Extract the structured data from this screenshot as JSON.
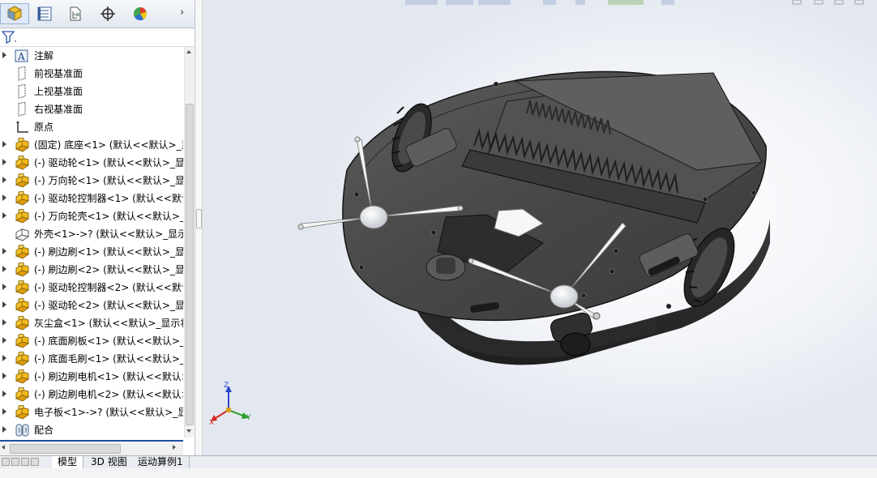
{
  "panel": {
    "tabs": [
      {
        "name": "feature-manager-tab-icon"
      },
      {
        "name": "property-manager-tab-icon"
      },
      {
        "name": "configuration-manager-tab-icon"
      },
      {
        "name": "dimxpert-manager-tab-icon"
      },
      {
        "name": "display-manager-tab-icon"
      }
    ],
    "more_arrow": "›",
    "filter_icon": "filter-icon",
    "tree": [
      {
        "label": "注解",
        "icon": "annotation-icon",
        "expandable": true
      },
      {
        "label": "前视基准面",
        "icon": "plane-icon",
        "expandable": false
      },
      {
        "label": "上视基准面",
        "icon": "plane-icon",
        "expandable": false
      },
      {
        "label": "右视基准面",
        "icon": "plane-icon",
        "expandable": false
      },
      {
        "label": "原点",
        "icon": "origin-icon",
        "expandable": false
      },
      {
        "label": "(固定) 底座<1> (默认<<默认>_显",
        "icon": "part-icon",
        "expandable": true
      },
      {
        "label": "(-) 驱动轮<1> (默认<<默认>_显示",
        "icon": "part-icon",
        "expandable": true
      },
      {
        "label": "(-) 万向轮<1> (默认<<默认>_显示",
        "icon": "part-icon",
        "expandable": true
      },
      {
        "label": "(-) 驱动轮控制器<1> (默认<<默认",
        "icon": "part-icon",
        "expandable": true
      },
      {
        "label": "(-) 万向轮壳<1> (默认<<默认>_显",
        "icon": "part-icon",
        "expandable": true
      },
      {
        "label": "外壳<1>->? (默认<<默认>_显示",
        "icon": "part-outline-icon",
        "expandable": false
      },
      {
        "label": "(-) 刷边刷<1> (默认<<默认>_显示",
        "icon": "part-icon",
        "expandable": true
      },
      {
        "label": "(-) 刷边刷<2> (默认<<默认>_显示",
        "icon": "part-icon",
        "expandable": true
      },
      {
        "label": "(-) 驱动轮控制器<2> (默认<<默认",
        "icon": "part-icon",
        "expandable": true
      },
      {
        "label": "(-) 驱动轮<2> (默认<<默认>_显示",
        "icon": "part-icon",
        "expandable": true
      },
      {
        "label": "灰尘盒<1> (默认<<默认>_显示状",
        "icon": "part-icon",
        "expandable": true
      },
      {
        "label": "(-) 底面刷板<1> (默认<<默认>_显",
        "icon": "part-icon",
        "expandable": true
      },
      {
        "label": "(-) 底面毛刷<1> (默认<<默认>_显",
        "icon": "part-icon",
        "expandable": true
      },
      {
        "label": "(-) 刷边刷电机<1> (默认<<默认>",
        "icon": "part-icon",
        "expandable": true
      },
      {
        "label": "(-) 刷边刷电机<2> (默认<<默认>",
        "icon": "part-icon",
        "expandable": true
      },
      {
        "label": "电子板<1>->? (默认<<默认>_显",
        "icon": "part-icon",
        "expandable": true
      },
      {
        "label": "配合",
        "icon": "mates-icon",
        "expandable": true
      }
    ]
  },
  "viewport": {
    "model_name": "robot-vacuum-model",
    "triad": {
      "x": "X",
      "y": "Y",
      "z": "Z"
    }
  },
  "bottom_tabs": [
    "模型",
    "3D 视图",
    "运动算例1"
  ],
  "colors": {
    "selected_tab": "#dfe9f7",
    "scroll_accent": "#1b4fa8",
    "part_icon": "#f2b81a",
    "axis_x": "#d2261f",
    "axis_y": "#2a9d2a",
    "axis_z": "#2c45c9"
  }
}
